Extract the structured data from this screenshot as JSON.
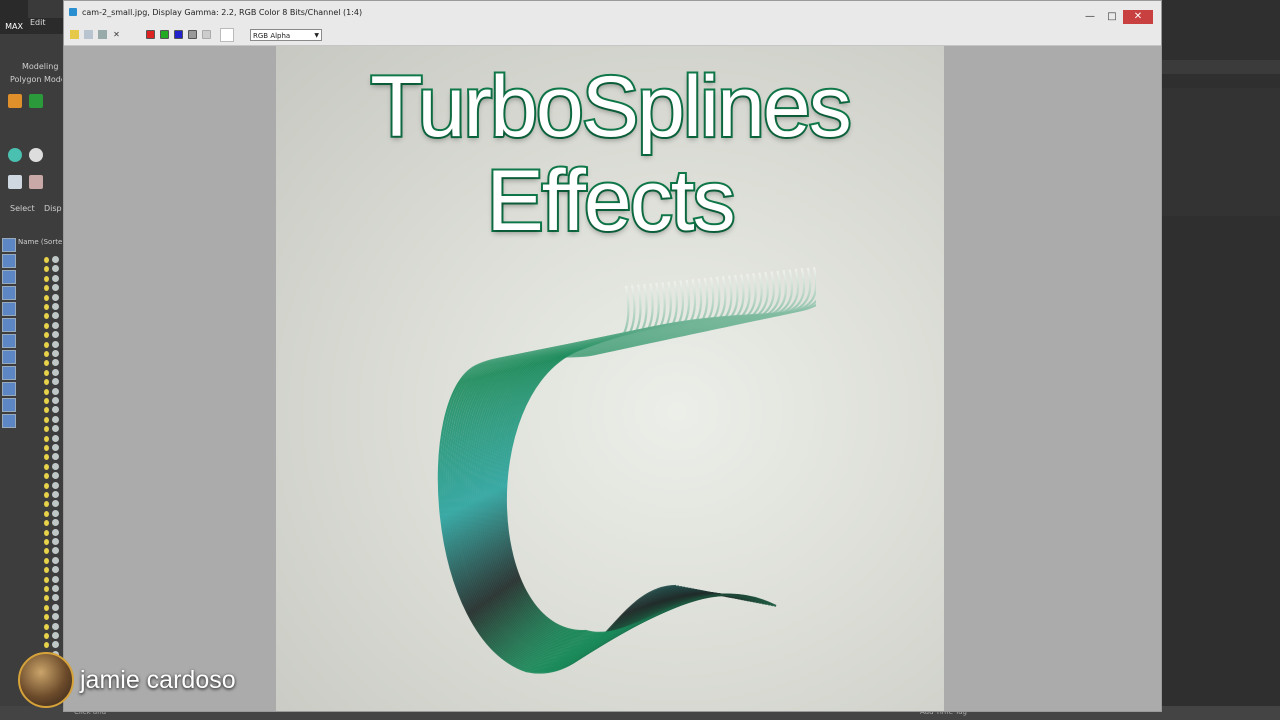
{
  "window": {
    "title": "cam-2_small.jpg, Display Gamma: 2.2, RGB Color 8 Bits/Channel (1:4)",
    "channel_select": "RGB Alpha",
    "controls": {
      "minimize": "—",
      "maximize": "□",
      "close": "✕"
    }
  },
  "max_ui": {
    "logo": "MAX",
    "menu_edit": "Edit",
    "ribbon_tab": "Modeling",
    "ribbon_sub": "Polygon Modeling",
    "explorer_tab_select": "Select",
    "explorer_tab_display": "Display",
    "column_name": "Name (Sorted",
    "status_prompt": "Click and",
    "add_time_tag": "Add Time Tag"
  },
  "image": {
    "headline_line1": "TurboSplines",
    "headline_line2": "Effects"
  },
  "overlay": {
    "presenter_name": "jamie cardoso"
  },
  "colors": {
    "headline_stroke": "#0f7a4a",
    "chair_green": "#1a8a5a",
    "chair_teal": "#2aa4a0",
    "close_red": "#c84040"
  }
}
